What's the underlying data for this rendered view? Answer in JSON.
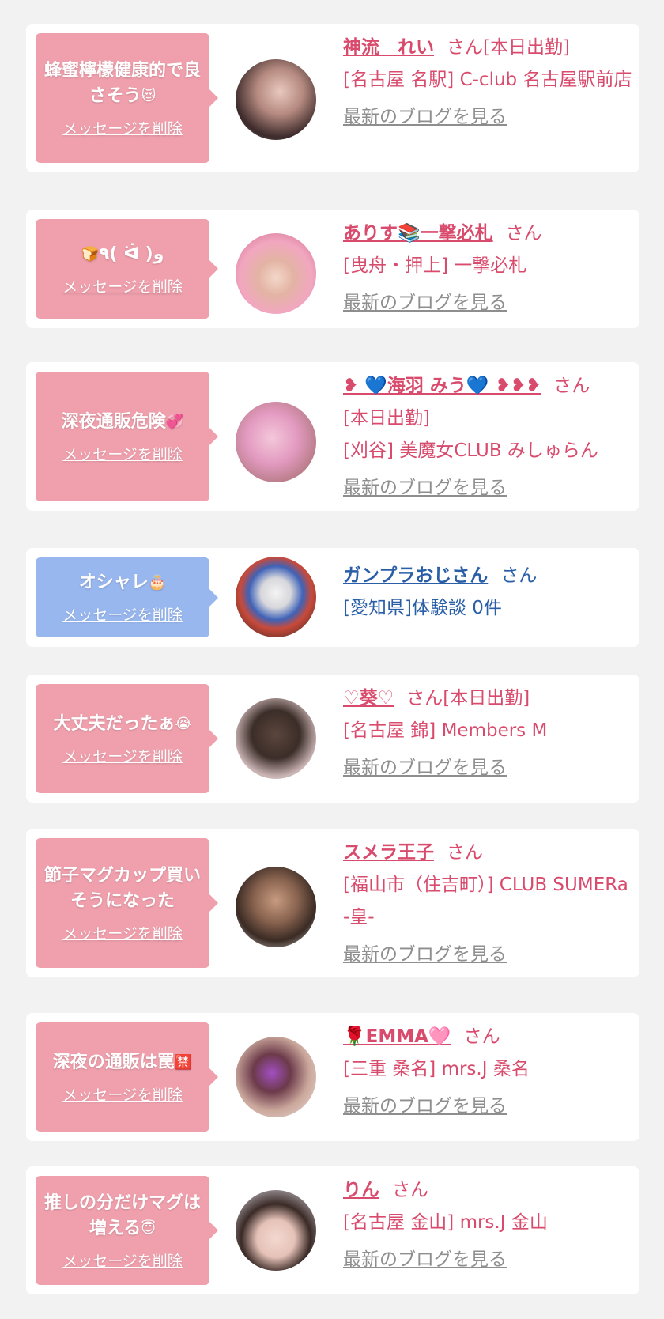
{
  "delete_label": "メッセージを削除",
  "blog_label": "最新のブログを見る",
  "honorific": "さん",
  "cards": [
    {
      "message": "蜂蜜檸檬健康的で良さそう",
      "message_emoji": "😻",
      "name": "神流　れい",
      "status": "[本日出勤]",
      "shop": "[名古屋 名駅] C-club 名古屋駅前店",
      "color": "#f0a0ad"
    },
    {
      "message": "٩( ᐛ )و",
      "message_emoji": "🍞",
      "name": "ありす📚一撃必札",
      "shop": "[曳舟・押上] 一撃必札",
      "color": "#f0a0ad"
    },
    {
      "message": "深夜通販危険",
      "message_emoji": "💞",
      "name": "❥ 💙海羽 みう💙 ❥❥❥",
      "status": "[本日出勤]",
      "shop": "[刈谷] 美魔女CLUB みしゅらん",
      "color": "#f0a0ad"
    },
    {
      "message": "オシャレ",
      "message_emoji": "🎂",
      "name": "ガンプラおじさん",
      "shop": "[愛知県]体験談 0件",
      "color": "#98b7ef"
    },
    {
      "message": "大丈夫だったぁ",
      "message_emoji": "😭",
      "name": "♡葵♡",
      "status": "[本日出勤]",
      "shop": "[名古屋 錦] Members M",
      "color": "#f0a0ad"
    },
    {
      "message": "節子マグカップ買いそうになった",
      "name": "スメラ王子",
      "shop": "[福山市（住吉町）] CLUB SUMERa -皇-",
      "color": "#f0a0ad"
    },
    {
      "message": "深夜の通販は罠",
      "message_emoji": "🈲",
      "name": "🌹EMMA🩷",
      "shop": "[三重 桑名] mrs.J 桑名",
      "color": "#f0a0ad"
    },
    {
      "message": "推しの分だけマグは増える",
      "message_emoji": "😇",
      "name": "りん",
      "shop": "[名古屋 金山] mrs.J 金山",
      "color": "#f0a0ad"
    }
  ]
}
